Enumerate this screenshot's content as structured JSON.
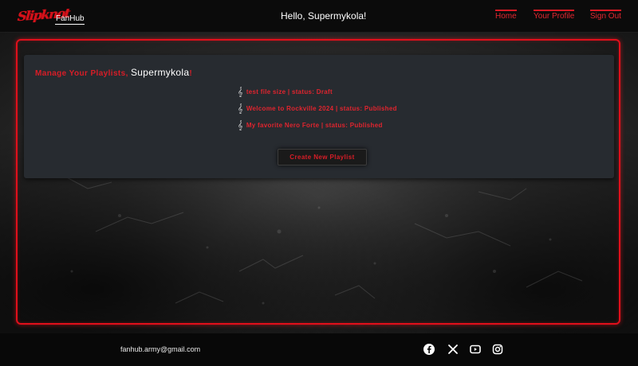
{
  "header": {
    "logo": {
      "main": "Slipknot",
      "sub": "FanHub"
    },
    "greeting_prefix": "Hello, ",
    "greeting_name": "Supermykola!",
    "nav": [
      {
        "label": "Home"
      },
      {
        "label": "Your Profile"
      },
      {
        "label": "Sign Out"
      }
    ]
  },
  "panel": {
    "title_prefix": "Manage Your Playlists, ",
    "title_name": "Supermykola",
    "title_suffix": "!",
    "playlists": [
      {
        "label": "test file size | status: Draft",
        "icon": "treble-clef-icon"
      },
      {
        "label": "Welcome to Rockville 2024 | status: Published",
        "icon": "treble-clef-icon"
      },
      {
        "label": "My favorite Nero Forte | status: Published",
        "icon": "treble-clef-icon"
      }
    ],
    "create_button": "Create New Playlist"
  },
  "footer": {
    "email": "fanhub.army@gmail.com",
    "social": [
      {
        "icon": "facebook-icon"
      },
      {
        "icon": "x-icon"
      },
      {
        "icon": "youtube-icon"
      },
      {
        "icon": "instagram-icon"
      }
    ]
  },
  "colors": {
    "accent_red": "#e10f1b",
    "header_bg": "#0b0b0b",
    "panel_bg": "#272b30",
    "footer_bg": "#080808"
  }
}
